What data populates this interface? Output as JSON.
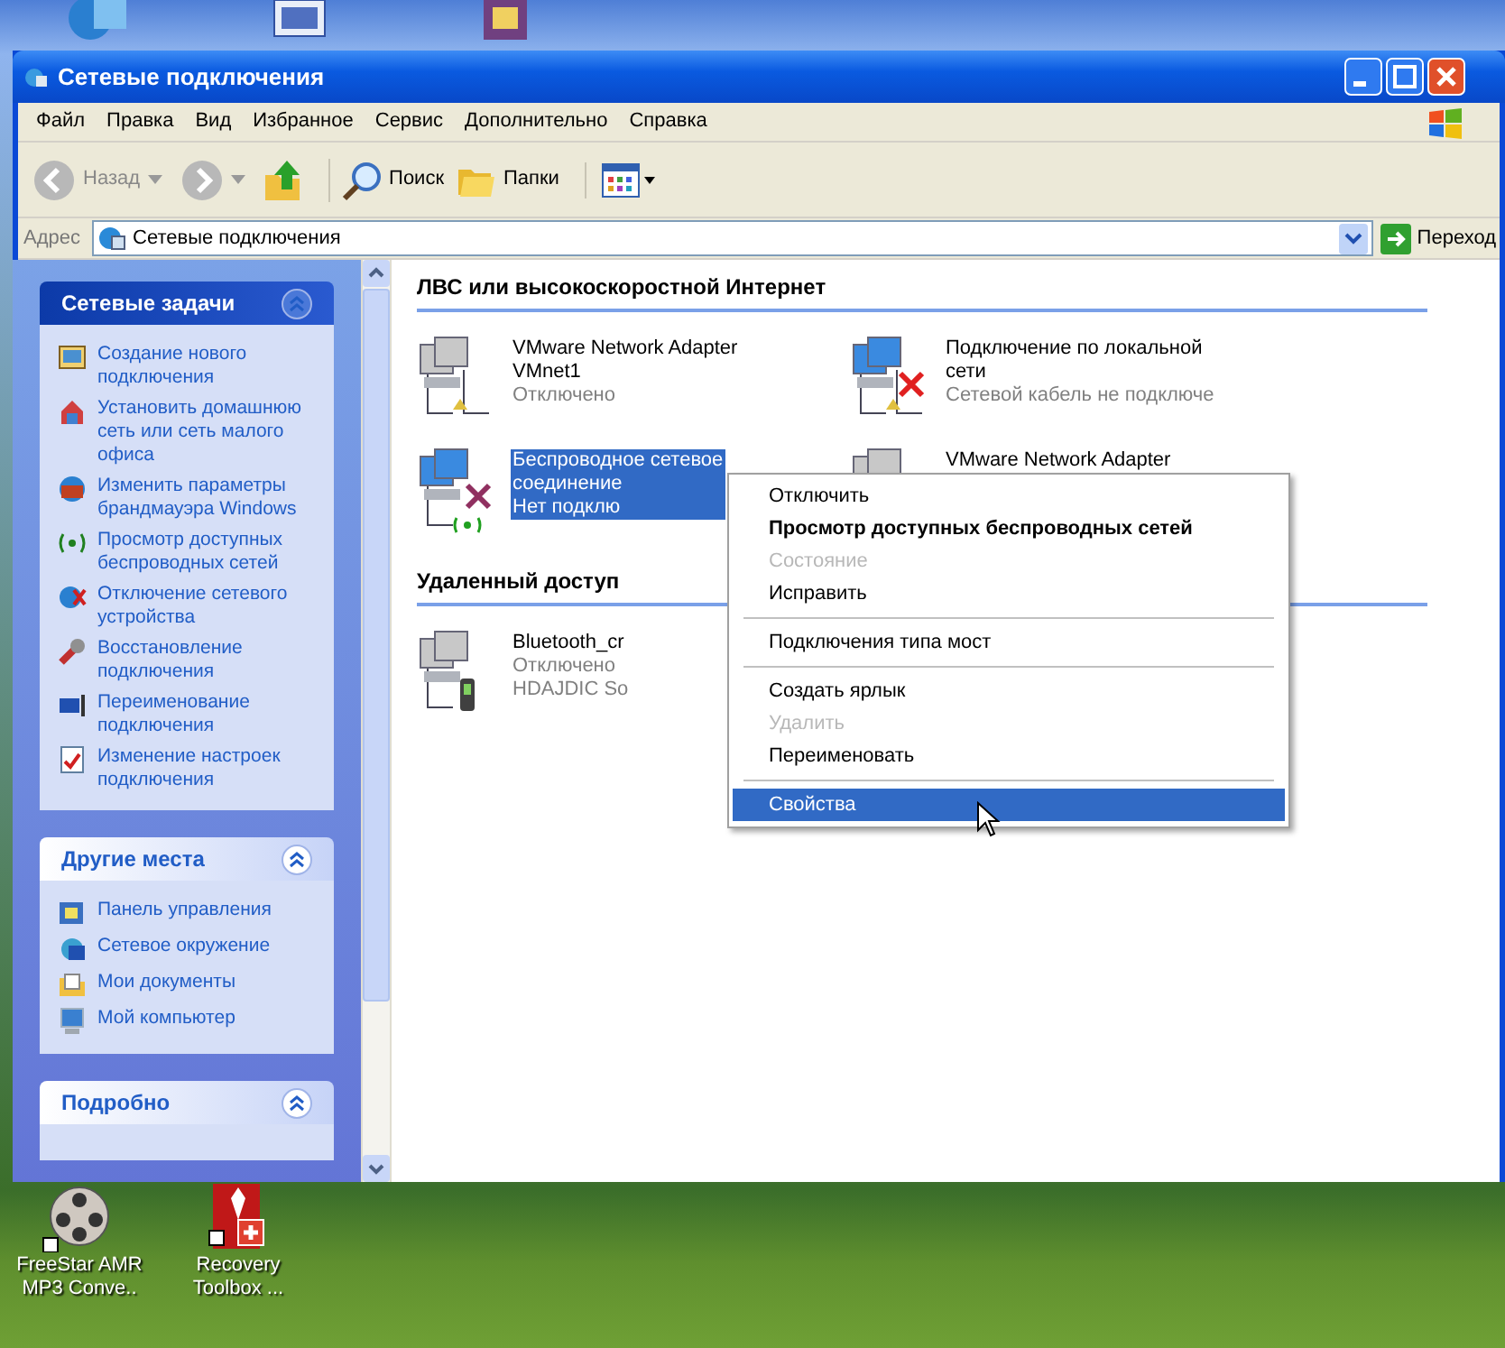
{
  "desktop_top_icons": [
    {
      "kind": "globe"
    },
    {
      "kind": "doc"
    },
    {
      "kind": "frame"
    }
  ],
  "window": {
    "title": "Сетевые подключения"
  },
  "menu_bar": [
    "Файл",
    "Правка",
    "Вид",
    "Избранное",
    "Сервис",
    "Дополнительно",
    "Справка"
  ],
  "toolbar": [
    {
      "kind": "back",
      "label": "Назад"
    },
    {
      "kind": "forward"
    },
    {
      "kind": "up"
    },
    {
      "kind": "search",
      "label": "Поиск"
    },
    {
      "kind": "folders",
      "label": "Папки"
    },
    {
      "kind": "views"
    }
  ],
  "address_bar": {
    "label": "Адрес",
    "value": "Сетевые подключения",
    "go": "Переход"
  },
  "task_panes": [
    {
      "kind": "primary",
      "title": "Сетевые задачи",
      "items": [
        {
          "kind": "new",
          "label": "Создание нового подключения"
        },
        {
          "kind": "home",
          "label": "Установить домашнюю сеть или сеть малого офиса"
        },
        {
          "kind": "firewall",
          "label": "Изменить параметры брандмауэра Windows"
        },
        {
          "kind": "wireless",
          "label": "Просмотр доступных беспроводных сетей"
        },
        {
          "kind": "disable",
          "label": "Отключение сетевого устройства"
        },
        {
          "kind": "repair",
          "label": "Восстановление подключения"
        },
        {
          "kind": "rename",
          "label": "Переименование подключения"
        },
        {
          "kind": "settings",
          "label": "Изменение настроек подключения"
        }
      ]
    },
    {
      "kind": "secondary",
      "title": "Другие места",
      "items": [
        {
          "kind": "panel",
          "label": "Панель управления"
        },
        {
          "kind": "network",
          "label": "Сетевое окружение"
        },
        {
          "kind": "docs",
          "label": "Мои документы"
        },
        {
          "kind": "computer",
          "label": "Мой компьютер"
        }
      ]
    },
    {
      "kind": "secondary",
      "title": "Подробно"
    }
  ],
  "groups": [
    {
      "title": "ЛВС или высокоскоростной Интернет",
      "items": [
        {
          "kind": "lan",
          "enabled": false,
          "error": false,
          "selected": false,
          "lines": [
            "VMware Network Adapter",
            "VMnet1"
          ],
          "status": "Отключено"
        },
        {
          "kind": "lan",
          "enabled": true,
          "error": true,
          "selected": false,
          "lines": [
            "Подключение по локальной",
            "сети"
          ],
          "status": "Сетевой кабель не подключе"
        },
        {
          "kind": "wireless",
          "enabled": true,
          "error": true,
          "selected": true,
          "lines": [
            "Беспроводное сетевое",
            "соединение"
          ],
          "status": "Нет подклю"
        },
        {
          "kind": "lan",
          "enabled": false,
          "selected": false,
          "lines": [
            "VMware Network Adapter"
          ]
        }
      ]
    },
    {
      "title": "Удаленный доступ",
      "items": [
        {
          "kind": "bluetooth",
          "enabled": false,
          "error": false,
          "selected": false,
          "lines": [
            "Bluetooth_cr"
          ],
          "status": "Отключено",
          "extra": "HDAJDIC So"
        }
      ]
    }
  ],
  "context_menu": [
    {
      "kind": "item",
      "label": "Отключить",
      "bold": false,
      "disabled": false,
      "selected": false
    },
    {
      "kind": "item",
      "label": "Просмотр доступных беспроводных сетей",
      "bold": true,
      "disabled": false,
      "selected": false
    },
    {
      "kind": "item",
      "label": "Состояние",
      "bold": false,
      "disabled": true,
      "selected": false
    },
    {
      "kind": "item",
      "label": "Исправить",
      "bold": false,
      "disabled": false,
      "selected": false
    },
    {
      "kind": "separator"
    },
    {
      "kind": "item",
      "label": "Подключения типа мост",
      "bold": false,
      "disabled": false,
      "selected": false
    },
    {
      "kind": "separator"
    },
    {
      "kind": "item",
      "label": "Создать ярлык",
      "bold": false,
      "disabled": false,
      "selected": false
    },
    {
      "kind": "item",
      "label": "Удалить",
      "bold": false,
      "disabled": true,
      "selected": false
    },
    {
      "kind": "item",
      "label": "Переименовать",
      "bold": false,
      "disabled": false,
      "selected": false
    },
    {
      "kind": "separator"
    },
    {
      "kind": "item",
      "label": "Свойства",
      "bold": false,
      "disabled": false,
      "selected": true
    }
  ],
  "desktop_icons": [
    {
      "kind": "film",
      "label": "FreeStar AMR MP3 Conve.."
    },
    {
      "kind": "toolbox",
      "label": "Recovery Toolbox ..."
    }
  ]
}
